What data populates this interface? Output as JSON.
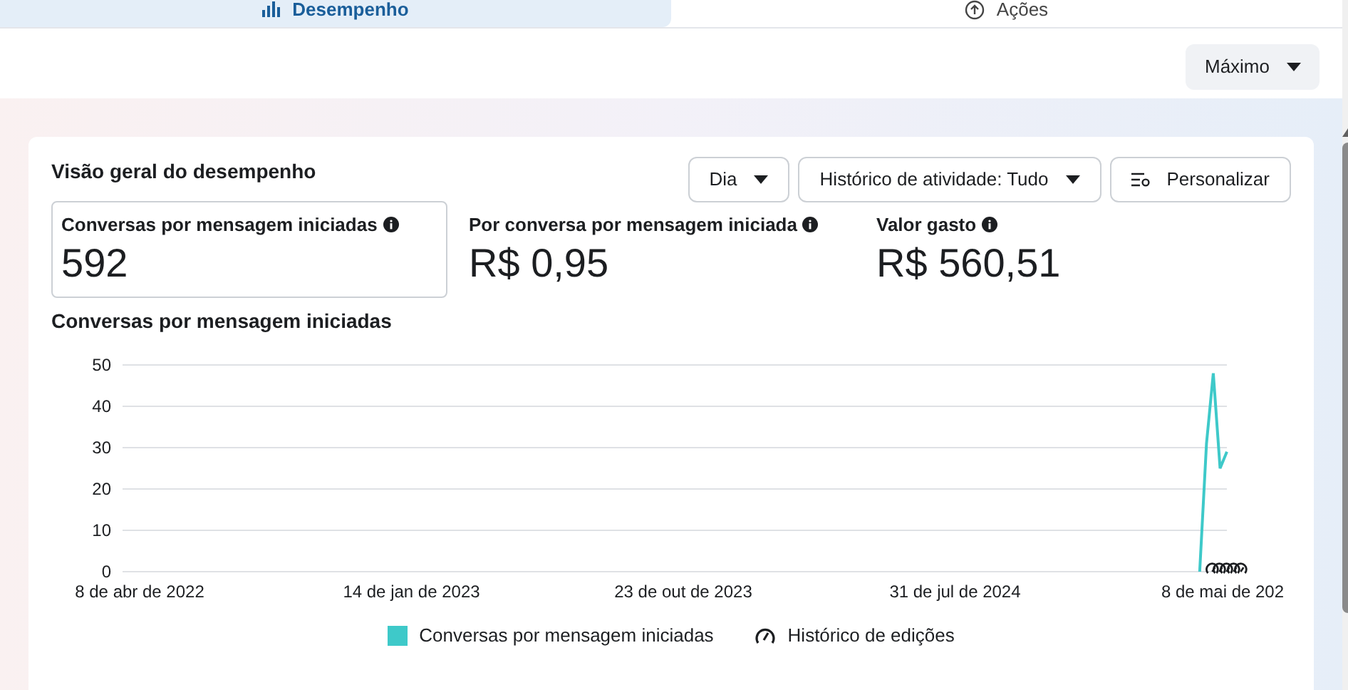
{
  "tabs": [
    {
      "label": "Desempenho",
      "selected": true
    },
    {
      "label": "Ações",
      "selected": false
    }
  ],
  "range_dropdown": {
    "value": "Máximo"
  },
  "card": {
    "title": "Visão geral do desempenho",
    "controls": [
      {
        "kind": "dropdown",
        "label": "Dia"
      },
      {
        "kind": "dropdown",
        "label": "Histórico de atividade: Tudo"
      },
      {
        "kind": "customize",
        "label": "Personalizar"
      }
    ],
    "metrics": [
      {
        "label": "Conversas por mensagem iniciadas",
        "value": "592",
        "selected": true
      },
      {
        "label": "Por conversa por mensagem iniciada",
        "value": "R$ 0,95",
        "selected": false
      },
      {
        "label": "Valor gasto",
        "value": "R$ 560,51",
        "selected": false
      }
    ],
    "chart_title": "Conversas por mensagem iniciadas",
    "chart_data": {
      "type": "line",
      "categories": [
        "8 de abr de 2022",
        null,
        null,
        null,
        null,
        null,
        null,
        null,
        null,
        null,
        null,
        null,
        null,
        null,
        null,
        null,
        null,
        null,
        null,
        null,
        null,
        null,
        null,
        null,
        null,
        null,
        null,
        null,
        null,
        null,
        null,
        null,
        null,
        null,
        null,
        null,
        null,
        null,
        null,
        null,
        "14 de jan de 2023",
        null,
        null,
        null,
        null,
        null,
        null,
        null,
        null,
        null,
        null,
        null,
        null,
        null,
        null,
        null,
        null,
        null,
        null,
        null,
        null,
        null,
        null,
        null,
        null,
        null,
        null,
        null,
        null,
        null,
        null,
        null,
        null,
        null,
        null,
        null,
        null,
        null,
        null,
        null,
        "23 de out de 2023",
        null,
        null,
        null,
        null,
        null,
        null,
        null,
        null,
        null,
        null,
        null,
        null,
        null,
        null,
        null,
        null,
        null,
        null,
        null,
        null,
        null,
        null,
        null,
        null,
        null,
        null,
        null,
        null,
        null,
        null,
        null,
        null,
        null,
        null,
        null,
        null,
        null,
        null,
        null,
        "31 de jul de 2024",
        null,
        null,
        null,
        null,
        null,
        null,
        null,
        null,
        null,
        null,
        null,
        null,
        null,
        null,
        null,
        null,
        null,
        null,
        null,
        null,
        null,
        null,
        null,
        null,
        null,
        null,
        null,
        null,
        null,
        null,
        null,
        null,
        null,
        null,
        null,
        null,
        null,
        null,
        null,
        "8 de mai de 202"
      ],
      "series": [
        {
          "name": "Conversas por mensagem iniciadas",
          "color": "#3ec9c9",
          "values": [
            null,
            null,
            null,
            null,
            null,
            null,
            null,
            null,
            null,
            null,
            null,
            null,
            null,
            null,
            null,
            null,
            null,
            null,
            null,
            null,
            null,
            null,
            null,
            null,
            null,
            null,
            null,
            null,
            null,
            null,
            null,
            null,
            null,
            null,
            null,
            null,
            null,
            null,
            null,
            null,
            null,
            null,
            null,
            null,
            null,
            null,
            null,
            null,
            null,
            null,
            null,
            null,
            null,
            null,
            null,
            null,
            null,
            null,
            null,
            null,
            null,
            null,
            null,
            null,
            null,
            null,
            null,
            null,
            null,
            null,
            null,
            null,
            null,
            null,
            null,
            null,
            null,
            null,
            null,
            null,
            null,
            null,
            null,
            null,
            null,
            null,
            null,
            null,
            null,
            null,
            null,
            null,
            null,
            null,
            null,
            null,
            null,
            null,
            null,
            null,
            null,
            null,
            null,
            null,
            null,
            null,
            null,
            null,
            null,
            null,
            null,
            null,
            null,
            null,
            null,
            null,
            null,
            null,
            null,
            null,
            null,
            null,
            null,
            null,
            null,
            null,
            null,
            null,
            null,
            null,
            null,
            null,
            null,
            null,
            null,
            null,
            null,
            null,
            null,
            null,
            null,
            null,
            null,
            null,
            null,
            null,
            null,
            null,
            null,
            null,
            null,
            null,
            null,
            null,
            null,
            null,
            0,
            31,
            48,
            25,
            29
          ]
        }
      ],
      "ylim": [
        0,
        50
      ],
      "yticks": [
        0,
        10,
        20,
        30,
        40,
        50
      ],
      "grid": true
    },
    "legend": [
      {
        "kind": "series"
      },
      {
        "kind": "edit-history",
        "label": "Histórico de edições"
      }
    ]
  }
}
